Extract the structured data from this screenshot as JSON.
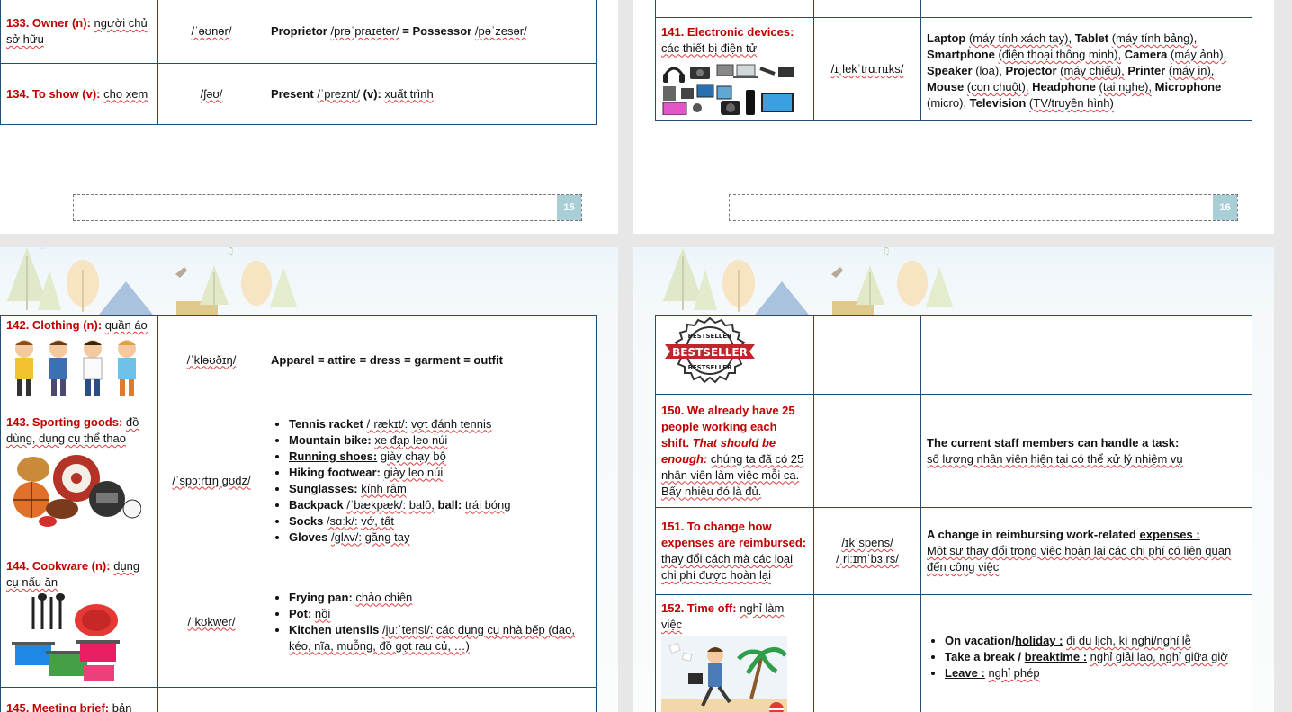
{
  "p15": {
    "rows": [
      {
        "term": "133. Owner (n):",
        "meaning": "người chủ sở hữu",
        "ipa": "/ˈəʊnər/",
        "def_a": "Proprietor",
        "def_a_ipa": "/prəˈpraɪətər/",
        "def_eq": "=",
        "def_b": "Possessor",
        "def_b_ipa": "/pəˈzesər/"
      },
      {
        "term": "134. To show (v):",
        "meaning": "cho xem",
        "ipa": "/ʃəʊ/",
        "def_a": "Present",
        "def_a_ipa": "/ˈpreznt/",
        "def_pos": "(v):",
        "def_meaning": "xuất trình"
      }
    ],
    "page_number": "15"
  },
  "p16": {
    "row": {
      "term": "141. Electronic devices:",
      "meaning": "các thiết bị điện tử",
      "ipa": "/ɪˌlekˈtrɑːnɪks/",
      "items": [
        {
          "en": "Laptop",
          "vi": "(máy tính xách tay),"
        },
        {
          "en": "Tablet",
          "vi": "(máy tính bảng),"
        },
        {
          "en": "Smartphone",
          "vi": "(điện thoại thông minh),"
        },
        {
          "en": "Camera",
          "vi": "(máy ảnh),"
        },
        {
          "en": "Speaker",
          "vi": "(loa),"
        },
        {
          "en": "Projector",
          "vi": "(máy chiếu),"
        },
        {
          "en": "Printer",
          "vi": "(máy in),"
        },
        {
          "en": "Mouse",
          "vi": "(con chuột),"
        },
        {
          "en": "Headphone",
          "vi": "(tai nghe),"
        },
        {
          "en": "Microphone",
          "vi": "(micro),"
        },
        {
          "en": "Television",
          "vi": "(TV/truyền hình)"
        }
      ]
    },
    "page_number": "16"
  },
  "p17": {
    "r142": {
      "term": "142. Clothing (n):",
      "meaning": "quần áo",
      "ipa": "/ˈkləʊðɪŋ/",
      "synonyms": "Apparel = attire = dress = garment = outfit"
    },
    "r143": {
      "term": "143. Sporting goods:",
      "meaning": "đồ dùng, dụng cụ thể thao",
      "ipa": "/ˈspɔːrtɪŋ ɡʊdz/",
      "items": [
        {
          "en": "Tennis racket",
          "ipa": "/ˈrækɪt/:",
          "vi": "vợt đánh tennis"
        },
        {
          "en": "Mountain bike:",
          "ipa": "",
          "vi": "xe đạp leo núi"
        },
        {
          "en": "Running  shoes:",
          "ipa": "",
          "vi": "giày chạy bộ"
        },
        {
          "en": "Hiking footwear:",
          "ipa": "",
          "vi": "giày leo núi"
        },
        {
          "en": "Sunglasses:",
          "ipa": "",
          "vi": "kính râm"
        },
        {
          "en": "Backpack",
          "ipa": "/ˈbækpæk/:",
          "vi": "balô,"
        },
        {
          "en": "Socks",
          "ipa": "/sɑːk/:",
          "vi": "vớ, tất"
        },
        {
          "en": "Gloves",
          "ipa": "/ɡlʌv/:",
          "vi": "găng tay"
        }
      ],
      "ball_label": "ball:",
      "ball_vi": "trái bóng"
    },
    "r144": {
      "term": "144. Cookware (n):",
      "meaning": "dụng cụ nấu ăn",
      "ipa": "/ˈkʊkwer/",
      "items": [
        {
          "en": "Frying pan:",
          "ipa": "",
          "vi": "chảo chiên"
        },
        {
          "en": "Pot:",
          "ipa": "",
          "vi": "nồi"
        },
        {
          "en": "Kitchen utensils",
          "ipa": "/juːˈtensl/:",
          "vi": "các dụng cụ nhà bếp (dao, kéo, nĩa, muỗng, đồ gọt rau củ, …)"
        }
      ]
    },
    "r145": {
      "term": "145. Meeting brief:",
      "meaning": "bản"
    }
  },
  "p18": {
    "badge": {
      "top": "BESTSELLER",
      "main": "BESTSELLER",
      "bottom": "BESTSELLER"
    },
    "r150": {
      "term": "150. We already have 25 people working each shift.",
      "emph": "That should be enough:",
      "meaning": "chúng ta đã có 25 nhân viên làm việc mỗi ca. Bấy nhiêu đó là đủ.",
      "def_title": "The current staff members can handle a task:",
      "def_vi": "số lượng nhân viên hiện tại có thể xử lý nhiệm vụ"
    },
    "r151": {
      "term": "151. To change how expenses are reimbursed:",
      "meaning": "thay đổi cách mà các loại chi phí được hoàn lại",
      "ipa1": "/ɪkˈspens/",
      "ipa2": "/ˌriːɪmˈbɜːrs/",
      "def_title": "A change in reimbursing work-related",
      "def_key": "expenses :",
      "def_vi": "Một sự thay đổi trong việc hoàn lại các chi phí có liên quan đến công việc"
    },
    "r152": {
      "term": "152. Time off:",
      "meaning": "nghỉ làm việc",
      "items": [
        {
          "a": "On vacation/",
          "b": "holiday :",
          "vi": "đi du lịch, kì nghỉ/nghỉ lễ"
        },
        {
          "a": "Take a break /",
          "b": "breaktime :",
          "vi": "nghỉ giải lao, nghỉ giữa giờ"
        },
        {
          "a": "",
          "b": "Leave :",
          "vi": "nghỉ phép"
        }
      ]
    }
  }
}
